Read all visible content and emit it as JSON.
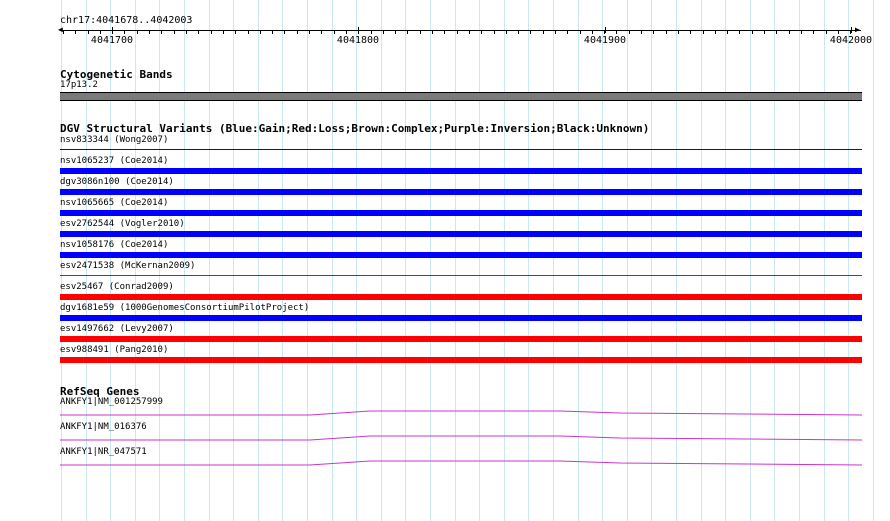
{
  "ruler": {
    "coordinates": "chr17:4041678..4042003",
    "ticks": [
      "4041700",
      "4041800",
      "4041900",
      "4042000"
    ]
  },
  "cytobands": {
    "title": "Cytogenetic Bands",
    "band_label": "17p13.2"
  },
  "dgv": {
    "title": "DGV Structural Variants (Blue:Gain;Red:Loss;Brown:Complex;Purple:Inversion;Black:Unknown)",
    "variants": [
      {
        "label": "nsv833344 (Wong2007)",
        "color": "#0000ff"
      },
      {
        "label": "nsv1065237 (Coe2014)",
        "color": "#0000ff"
      },
      {
        "label": "dgv3086n100 (Coe2014)",
        "color": "#0000ff"
      },
      {
        "label": "nsv1065665 (Coe2014)",
        "color": "#0000ff"
      },
      {
        "label": "esv2762544 (Vogler2010)",
        "color": "#0000ff"
      },
      {
        "label": "nsv1058176 (Coe2014)",
        "color": "#0000ff"
      },
      {
        "label": "esv2471538 (McKernan2009)",
        "color": "#ff0000"
      },
      {
        "label": "esv25467 (Conrad2009)",
        "color": "#ff0000"
      },
      {
        "label": "dgv1681e59 (1000GenomesConsortiumPilotProject)",
        "color": "#0000ff"
      },
      {
        "label": "esv1497662 (Levy2007)",
        "color": "#ff0000"
      },
      {
        "label": "esv988491 (Pang2010)",
        "color": "#ff0000"
      }
    ]
  },
  "refseq": {
    "title": "RefSeq Genes",
    "genes": [
      {
        "label": "ANKFY1|NM_001257999",
        "color": "#cc33cc"
      },
      {
        "label": "ANKFY1|NM_016376",
        "color": "#cc33cc"
      },
      {
        "label": "ANKFY1|NR_047571",
        "color": "#cc33cc"
      }
    ]
  }
}
